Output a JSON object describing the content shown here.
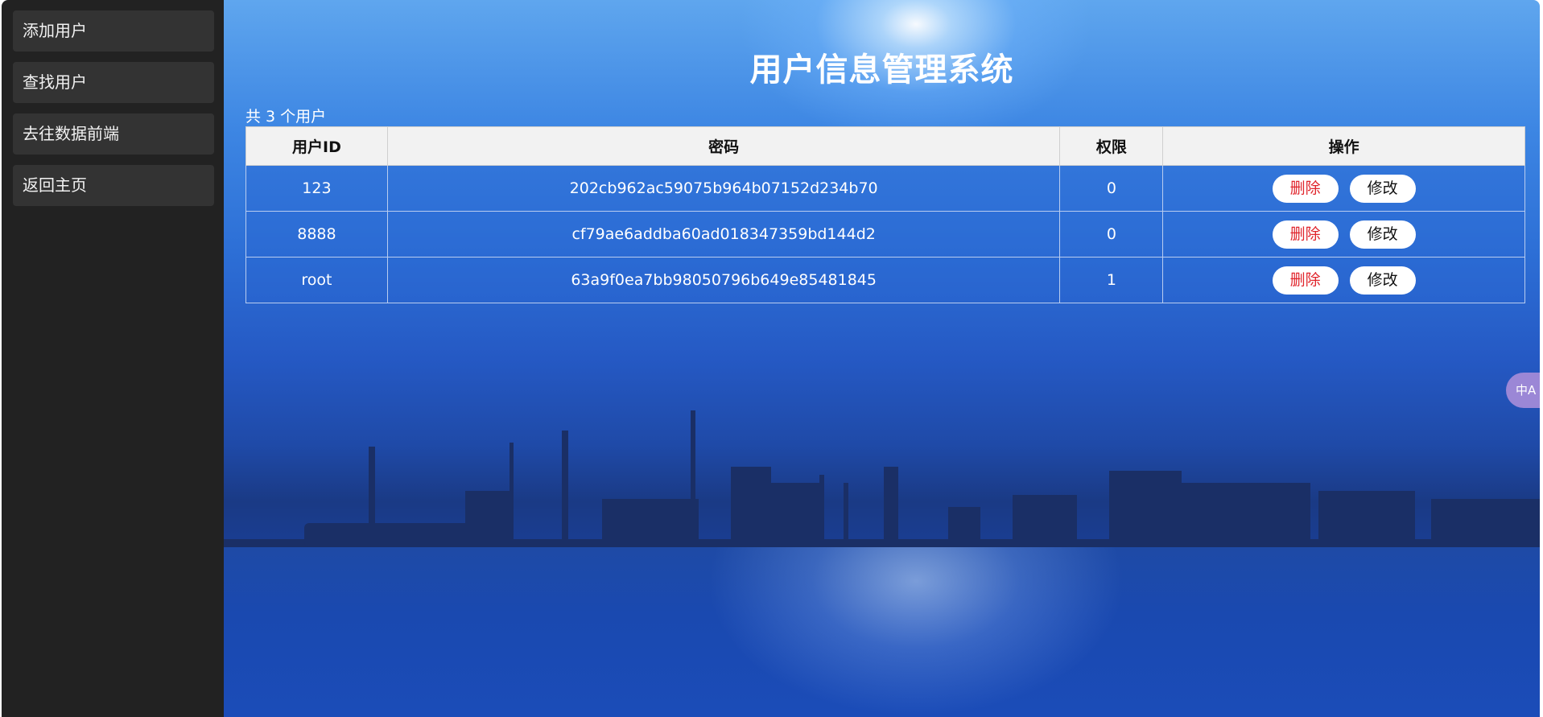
{
  "sidebar": {
    "items": [
      {
        "label": "添加用户"
      },
      {
        "label": "查找用户"
      },
      {
        "label": "去往数据前端"
      },
      {
        "label": "返回主页"
      }
    ]
  },
  "main": {
    "title": "用户信息管理系统",
    "count_text": "共 3 个用户"
  },
  "table": {
    "headers": [
      "用户ID",
      "密码",
      "权限",
      "操作"
    ],
    "rows": [
      {
        "id": "123",
        "password": "202cb962ac59075b964b07152d234b70",
        "permission": "0"
      },
      {
        "id": "8888",
        "password": "cf79ae6addba60ad018347359bd144d2",
        "permission": "0"
      },
      {
        "id": "root",
        "password": "63a9f0ea7bb98050796b649e85481845",
        "permission": "1"
      }
    ],
    "delete_label": "删除",
    "edit_label": "修改"
  },
  "widgets": {
    "translate_label": "中A",
    "ime": {
      "lang": "中",
      "punct": "°,",
      "moon": "◐",
      "shirt": "👕"
    }
  },
  "colors": {
    "sidebar_bg": "#222222",
    "nav_item_bg": "#333333",
    "delete_text": "#e0242b",
    "ime_accent": "#2fd6cf"
  }
}
